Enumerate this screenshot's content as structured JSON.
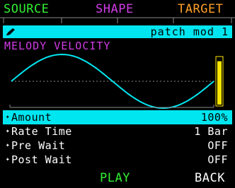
{
  "tabs": {
    "source": "SOURCE",
    "shape": "SHAPE",
    "target": "TARGET"
  },
  "patch": {
    "name": "patch mod 1",
    "icon": "pencil-icon"
  },
  "mod_title": "MELODY VELOCITY",
  "level_meter": {
    "color": "#ffe600",
    "level": 0.93
  },
  "params": [
    {
      "label": "Amount",
      "value": "100%",
      "selected": true
    },
    {
      "label": "Rate Time",
      "value": "1 Bar",
      "selected": false
    },
    {
      "label": "Pre Wait",
      "value": "OFF",
      "selected": false
    },
    {
      "label": "Post Wait",
      "value": "OFF",
      "selected": false
    }
  ],
  "footer": {
    "play": "PLAY",
    "back": "BACK"
  },
  "colors": {
    "source": "#32f032",
    "shape": "#d23ce6",
    "target": "#ffa028",
    "accent": "#00e6f0",
    "meter": "#ffe600"
  }
}
